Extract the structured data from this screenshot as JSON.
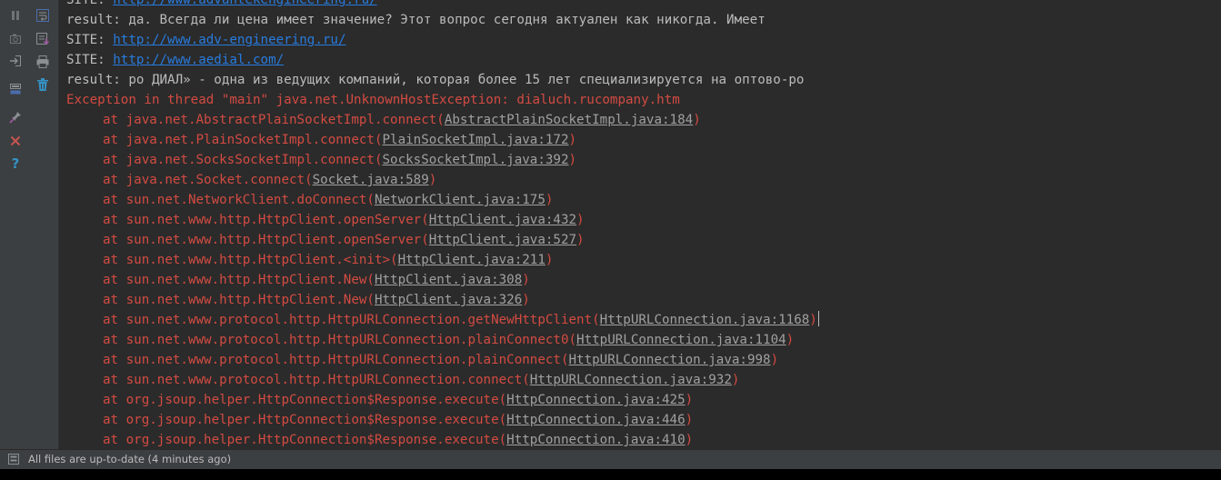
{
  "toolbar": {
    "left_icons": [
      "pause-icon",
      "camera-icon",
      "login-icon",
      "layout-icon",
      "pin-icon",
      "close-icon",
      "help-icon"
    ],
    "right_icons": [
      "soft-wrap-icon",
      "scroll-to-end-icon",
      "print-icon",
      "trash-icon"
    ],
    "colors": {
      "close": "#c75450",
      "help": "#3592c4",
      "icon": "#8a8f93"
    }
  },
  "console": {
    "lines": [
      {
        "type": "out",
        "segments": [
          {
            "text": "SITE: "
          },
          {
            "text": "http://www.advantekengineering.ru/",
            "link": true
          }
        ]
      },
      {
        "type": "out",
        "segments": [
          {
            "text": "result: да. Всегда ли цена имеет значение? Этот вопрос сегодня актуален как никогда. Имеет"
          }
        ]
      },
      {
        "type": "out",
        "segments": [
          {
            "text": "SITE: "
          },
          {
            "text": "http://www.adv-engineering.ru/",
            "link": true
          }
        ]
      },
      {
        "type": "out",
        "segments": [
          {
            "text": "SITE: "
          },
          {
            "text": "http://www.aedial.com/",
            "link": true
          }
        ]
      },
      {
        "type": "out",
        "segments": [
          {
            "text": "result: ро ДИАЛ» - одна из ведущих компаний, которая более 15 лет специализируется на оптово-ро"
          }
        ]
      },
      {
        "type": "err",
        "segments": [
          {
            "text": "Exception in thread \"main\" java.net.UnknownHostException: dialuch.rucompany.htm"
          }
        ]
      },
      {
        "type": "err",
        "indent": true,
        "segments": [
          {
            "text": "at java.net.AbstractPlainSocketImpl.connect("
          },
          {
            "text": "AbstractPlainSocketImpl.java:184",
            "link": true
          },
          {
            "text": ")"
          }
        ]
      },
      {
        "type": "err",
        "indent": true,
        "segments": [
          {
            "text": "at java.net.PlainSocketImpl.connect("
          },
          {
            "text": "PlainSocketImpl.java:172",
            "link": true
          },
          {
            "text": ")"
          }
        ]
      },
      {
        "type": "err",
        "indent": true,
        "segments": [
          {
            "text": "at java.net.SocksSocketImpl.connect("
          },
          {
            "text": "SocksSocketImpl.java:392",
            "link": true
          },
          {
            "text": ")"
          }
        ]
      },
      {
        "type": "err",
        "indent": true,
        "segments": [
          {
            "text": "at java.net.Socket.connect("
          },
          {
            "text": "Socket.java:589",
            "link": true
          },
          {
            "text": ")"
          }
        ]
      },
      {
        "type": "err",
        "indent": true,
        "segments": [
          {
            "text": "at sun.net.NetworkClient.doConnect("
          },
          {
            "text": "NetworkClient.java:175",
            "link": true
          },
          {
            "text": ")"
          }
        ]
      },
      {
        "type": "err",
        "indent": true,
        "segments": [
          {
            "text": "at sun.net.www.http.HttpClient.openServer("
          },
          {
            "text": "HttpClient.java:432",
            "link": true
          },
          {
            "text": ")"
          }
        ]
      },
      {
        "type": "err",
        "indent": true,
        "segments": [
          {
            "text": "at sun.net.www.http.HttpClient.openServer("
          },
          {
            "text": "HttpClient.java:527",
            "link": true
          },
          {
            "text": ")"
          }
        ]
      },
      {
        "type": "err",
        "indent": true,
        "segments": [
          {
            "text": "at sun.net.www.http.HttpClient.<init>("
          },
          {
            "text": "HttpClient.java:211",
            "link": true
          },
          {
            "text": ")"
          }
        ]
      },
      {
        "type": "err",
        "indent": true,
        "segments": [
          {
            "text": "at sun.net.www.http.HttpClient.New("
          },
          {
            "text": "HttpClient.java:308",
            "link": true
          },
          {
            "text": ")"
          }
        ]
      },
      {
        "type": "err",
        "indent": true,
        "segments": [
          {
            "text": "at sun.net.www.http.HttpClient.New("
          },
          {
            "text": "HttpClient.java:326",
            "link": true
          },
          {
            "text": ")"
          }
        ]
      },
      {
        "type": "err",
        "indent": true,
        "caret": true,
        "segments": [
          {
            "text": "at sun.net.www.protocol.http.HttpURLConnection.getNewHttpClient("
          },
          {
            "text": "HttpURLConnection.java:1168",
            "link": true
          },
          {
            "text": ")"
          }
        ]
      },
      {
        "type": "err",
        "indent": true,
        "segments": [
          {
            "text": "at sun.net.www.protocol.http.HttpURLConnection.plainConnect0("
          },
          {
            "text": "HttpURLConnection.java:1104",
            "link": true
          },
          {
            "text": ")"
          }
        ]
      },
      {
        "type": "err",
        "indent": true,
        "segments": [
          {
            "text": "at sun.net.www.protocol.http.HttpURLConnection.plainConnect("
          },
          {
            "text": "HttpURLConnection.java:998",
            "link": true
          },
          {
            "text": ")"
          }
        ]
      },
      {
        "type": "err",
        "indent": true,
        "segments": [
          {
            "text": "at sun.net.www.protocol.http.HttpURLConnection.connect("
          },
          {
            "text": "HttpURLConnection.java:932",
            "link": true
          },
          {
            "text": ")"
          }
        ]
      },
      {
        "type": "err",
        "indent": true,
        "segments": [
          {
            "text": "at org.jsoup.helper.HttpConnection$Response.execute("
          },
          {
            "text": "HttpConnection.java:425",
            "link": true
          },
          {
            "text": ")"
          }
        ]
      },
      {
        "type": "err",
        "indent": true,
        "segments": [
          {
            "text": "at org.jsoup.helper.HttpConnection$Response.execute("
          },
          {
            "text": "HttpConnection.java:446",
            "link": true
          },
          {
            "text": ")"
          }
        ]
      },
      {
        "type": "err",
        "indent": true,
        "segments": [
          {
            "text": "at org.jsoup.helper.HttpConnection$Response.execute("
          },
          {
            "text": "HttpConnection.java:410",
            "link": true
          },
          {
            "text": ")"
          }
        ]
      }
    ]
  },
  "statusbar": {
    "text": "All files are up-to-date (4 minutes ago)"
  }
}
